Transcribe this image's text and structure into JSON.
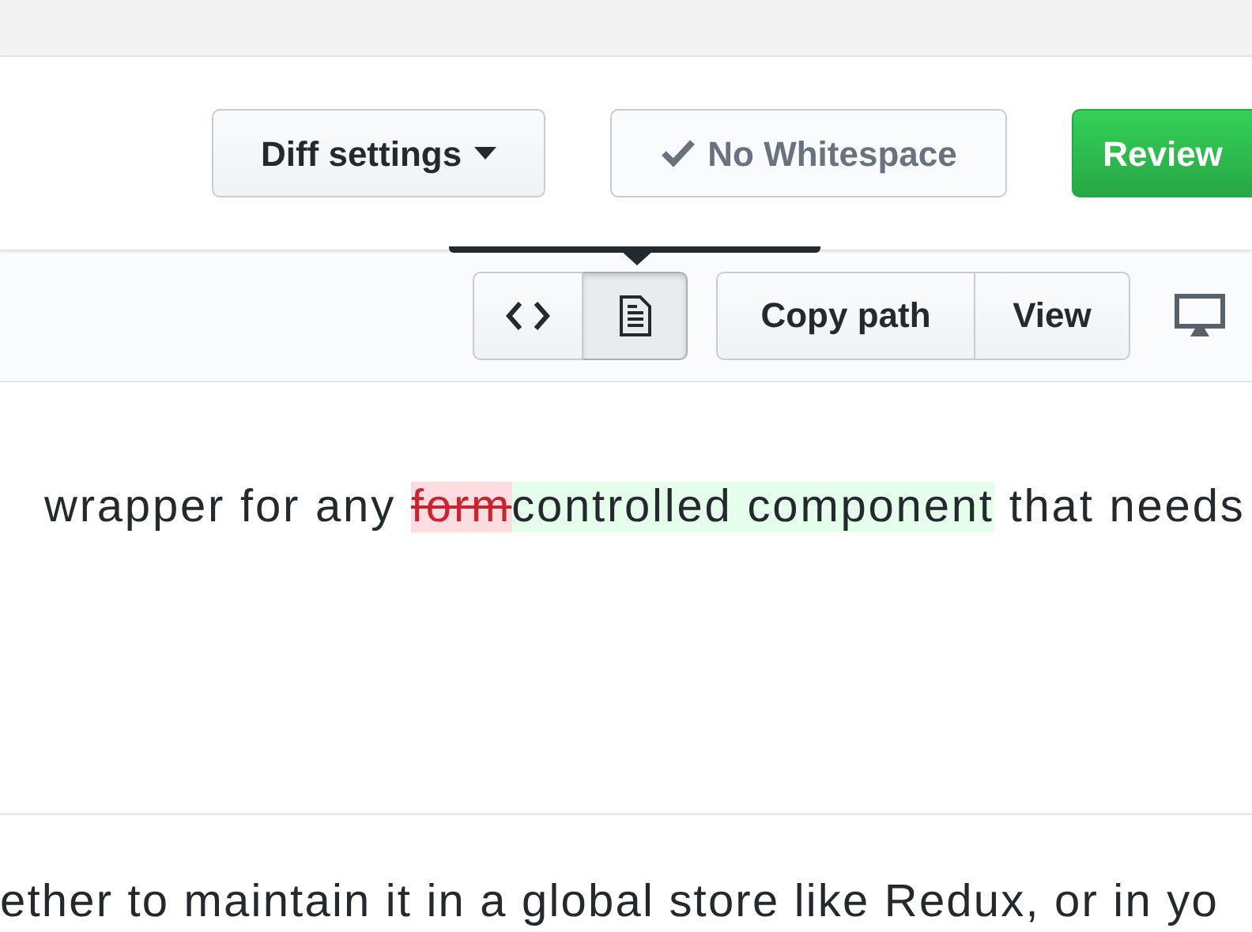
{
  "toolbar": {
    "buttons": [
      {
        "kind": "dropdown",
        "label": "Diff settings"
      },
      {
        "kind": "toggle",
        "label": "No Whitespace",
        "checked": true,
        "disabled": true
      },
      {
        "kind": "primary",
        "label": "Review"
      }
    ]
  },
  "file_header": {
    "view_modes": [
      {
        "kind": "source",
        "selected": false
      },
      {
        "kind": "rich",
        "selected": true
      }
    ],
    "actions": [
      "Copy path",
      "View"
    ]
  },
  "diff_lines": [
    {
      "segments": [
        {
          "kind": "normal",
          "text": "wrapper for any "
        },
        {
          "kind": "deleted",
          "text": "form"
        },
        {
          "kind": "added",
          "text": "controlled component"
        },
        {
          "kind": "normal",
          "text": " that needs"
        }
      ]
    },
    {
      "segments": [
        {
          "kind": "normal",
          "text": "ether to maintain it in a global store like Redux, or in yo"
        }
      ]
    }
  ]
}
